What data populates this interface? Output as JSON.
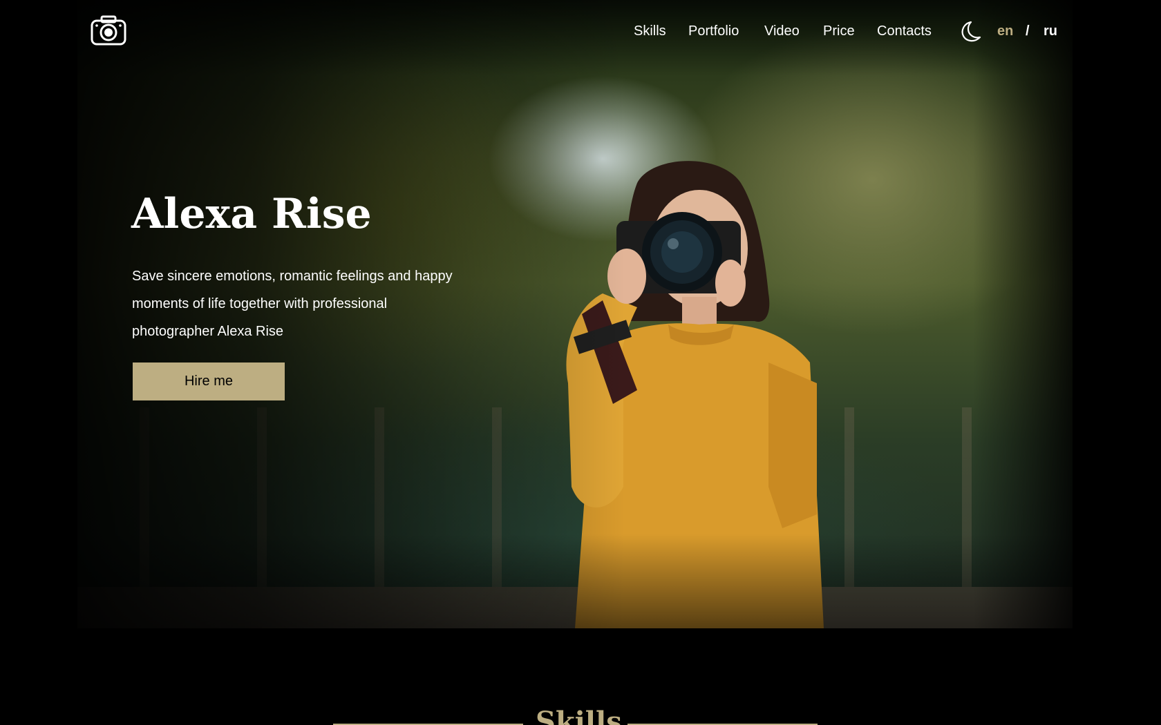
{
  "brand": {
    "logo_icon": "camera-icon"
  },
  "nav": {
    "items": [
      {
        "label": "Skills"
      },
      {
        "label": "Portfolio"
      },
      {
        "label": "Video"
      },
      {
        "label": "Price"
      },
      {
        "label": "Contacts"
      }
    ],
    "theme_icon": "moon-icon",
    "lang": {
      "en": "en",
      "separator": "/",
      "ru": "ru",
      "active": "en"
    }
  },
  "hero": {
    "title": "Alexa Rise",
    "text": "Save sincere emotions, romantic feelings and happy moments of life together with professional photographer Alexa Rise",
    "button_label": "Hire me"
  },
  "skills": {
    "title": "Skills"
  },
  "colors": {
    "accent": "#bdae82",
    "background": "#000000",
    "text": "#ffffff"
  }
}
